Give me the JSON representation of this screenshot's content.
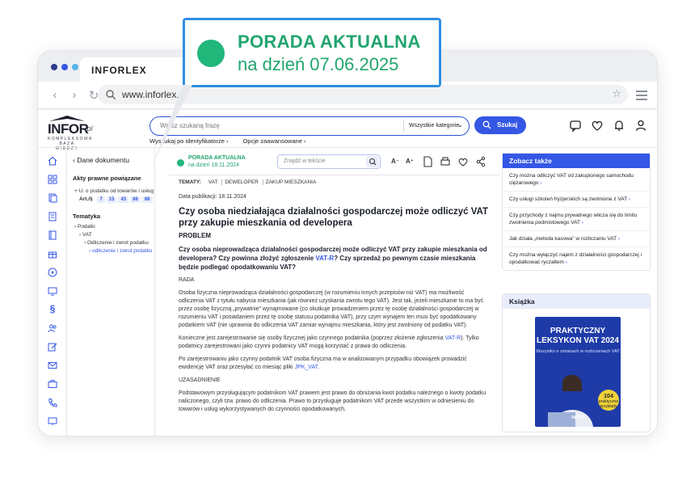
{
  "callout": {
    "line1": "PORADA AKTUALNA",
    "line2": "na dzień 07.06.2025"
  },
  "browser": {
    "tab_title": "INFORLEX",
    "url": "www.inforlex.pl",
    "dot_colors": [
      "#2d3a8c",
      "#3557e5",
      "#55b6ea"
    ]
  },
  "header": {
    "logo_text": "INFOR",
    "logo_suffix": ".pl",
    "logo_sub": "KOMPLEKSOWA BAZA WIEDZY",
    "search_placeholder": "Wpisz szukaną frazę",
    "category": "Wszystkie kategorie",
    "search_button": "Szukaj",
    "link_identifiers": "Wyszukaj po identyfikatorze",
    "link_advanced": "Opcje zaawansowane",
    "icons": [
      "comment-icon",
      "heart-icon",
      "bell-icon",
      "user-icon"
    ]
  },
  "left_panel": {
    "title": "Dane dokumentu",
    "acts_heading": "Akty prawne powiązane",
    "act_name": "U. o podatku od towarów i usług",
    "act_label": "Art./§",
    "act_articles": [
      "7",
      "15",
      "43",
      "86",
      "88"
    ],
    "topics_heading": "Tematyka",
    "topic_1": "Podatki",
    "topic_2": "VAT",
    "topic_3": "Odliczenie i zwrot podatku",
    "topic_4": "odliczenie i zwrot podatku"
  },
  "article": {
    "badge_line1": "PORADA AKTUALNA",
    "badge_line2": "na dzień 18.11.2024",
    "find_placeholder": "Znajdź w tekście",
    "topics_label": "TEMATY:",
    "topics": [
      "VAT",
      "DEWELOPER",
      "ZAKUP MIESZKANIA"
    ],
    "date_label": "Data publikacji: 18.11.2024",
    "title": "Czy osoba niedziałająca działalności gospodarczej może odliczyć VAT przy zakupie mieszkania od developera",
    "problem": "PROBLEM",
    "question_a": "Czy osoba nieprowadząca działalności gospodarczej może odliczyć VAT przy zakupie mieszkania od developera? Czy powinna złożyć zgłoszenie ",
    "question_link": "VAT-R",
    "question_b": "? Czy sprzedaż po pewnym czasie mieszkania będzie podlegać opodatkowaniu VAT?",
    "rada": "RADA",
    "p1": "Osoba fizyczna nieprowadząca działalności gospodarczej (w rozumieniu innych przepisów niż VAT) ma możliwość odliczenia VAT z tytułu nabycia mieszkania (jak również uzyskania zwrotu tego VAT). Jest tak, jeżeli mieszkanie to ma być przez osobę fizyczną „prywatnie” wynajmowane (co skutkuje prowadzeniem przez tę osobę działalności gospodarczej w rozumieniu VAT i posiadaniem przez tę osobę statusu podatnika VAT), przy czym wynajem ten musi być opodatkowany podatkiem VAT (nie uprawnia do odliczenia VAT zamiar wynajmu mieszkania, który jest zwolniony od podatku VAT).",
    "p2a": "Konieczne jest zarejestrowanie się osoby fizycznej jako czynnego podatnika (poprzez złożenie zgłoszenia ",
    "p2_link": "VAT-R",
    "p2b": "). Tylko podatnicy zarejestrowani jako czynni podatnicy VAT mogą korzystać z prawa do odliczenia.",
    "p3a": "Po zarejestrowaniu jako czynny podatnik VAT osoba fizyczna ma w analizowanym przypadku obowiązek prowadzić ewidencję VAT oraz przesyłać co miesiąc pliki ",
    "p3_link": "JPK_VAT",
    "p3b": ".",
    "uzasadnienie": "UZASADNIENIE",
    "p4": "Podstawowym przysługującym podatnikom VAT prawem jest prawo do obniżania kwot podatku należnego o kwoty podatku naliczonego, czyli tzw. prawo do odliczenia. Prawo to przysługuje podatnikom VAT przede wszystkim w odniesieniu do towarów i usług wykorzystywanych do czynności opodatkowanych."
  },
  "sidebar": {
    "see_also_title": "Zobacz także",
    "see_also": [
      "Czy można odliczyć VAT od zakupionego samochodu ciężarowego",
      "Czy usługi szkoleń fryzjerskich są zwolnione z VAT",
      "Czy przychody z najmu prywatnego wlicza się do limitu zwolnienia podmiotowego VAT",
      "Jak działa „metoda kasowa” w rozliczaniu VAT",
      "Czy można wyłączyć najem z działalności gospodarczej i opodatkować ryczałtem"
    ],
    "book_title": "Książka",
    "book_cover_title": "PRAKTYCZNY LEKSYKON VAT 2024",
    "book_cover_sub": "Wszystko o zmianach w rozliczeniach VAT",
    "book_badge_num": "104",
    "book_badge_text": "praktyczne przykłady",
    "book_brand": "INFOR"
  }
}
